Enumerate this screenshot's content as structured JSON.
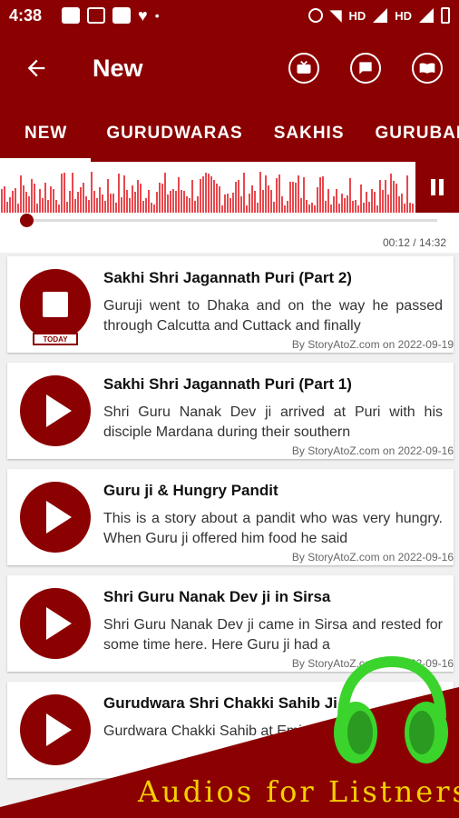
{
  "status_bar": {
    "time": "4:38",
    "icons_left": [
      "image-icon",
      "p-icon",
      "calendar-icon",
      "heart-icon"
    ],
    "dot": "•",
    "icons_right": [
      "dnd-icon",
      "wifi-icon",
      "signal-icon",
      "battery-icon"
    ],
    "hd1": "HD",
    "hd2": "HD"
  },
  "appbar": {
    "title": "New",
    "back_icon": "arrow-left-icon",
    "actions": [
      "tv-icon",
      "chat-icon",
      "book-icon"
    ]
  },
  "tabs": [
    {
      "label": "NEW",
      "active": true
    },
    {
      "label": "GURUDWARAS",
      "active": false
    },
    {
      "label": "SAKHIS",
      "active": false
    },
    {
      "label": "GURUBANI",
      "active": false
    }
  ],
  "player": {
    "time": "00:12 / 14:32",
    "progress": 0.014
  },
  "items": [
    {
      "title": "Sakhi Shri Jagannath Puri (Part 2)",
      "desc": "Guruji went to Dhaka and on the way he passed through Calcutta and Cuttack and finally",
      "meta": "By StoryAtoZ.com on 2022-09-19",
      "state": "playing",
      "badge": "TODAY"
    },
    {
      "title": "Sakhi Shri Jagannath Puri (Part 1)",
      "desc": "Shri Guru Nanak Dev ji arrived at Puri with his disciple Mardana during their southern",
      "meta": "By StoryAtoZ.com on 2022-09-16",
      "state": "play"
    },
    {
      "title": "Guru ji & Hungry Pandit",
      "desc": "This is a story about a pandit who was very hungry. When Guru ji offered him food he said",
      "meta": "By StoryAtoZ.com on 2022-09-16",
      "state": "play"
    },
    {
      "title": "Shri Guru Nanak Dev ji in Sirsa",
      "desc": "Shri Guru Nanak Dev ji came in Sirsa and rested for some time here. Here Guru ji had a",
      "meta": "By StoryAtoZ.com on 2022-09-16",
      "state": "play"
    },
    {
      "title": "Gurudwara Shri Chakki Sahib Ji",
      "desc": "Gurdwara Chakki Sahib at Eminabad where a large",
      "meta": "",
      "state": "play"
    }
  ],
  "promo": {
    "tagline": "Audios for Listners",
    "icon": "headphones-icon"
  },
  "colors": {
    "primary": "#8b0000",
    "tagline": "#f5d000",
    "headphones": "#3bd42c"
  }
}
